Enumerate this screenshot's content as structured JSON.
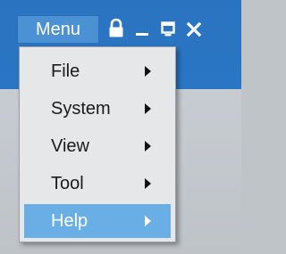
{
  "titlebar": {
    "menu_label": "Menu",
    "controls": [
      {
        "icon": "lock-icon"
      },
      {
        "icon": "minimize-icon"
      },
      {
        "icon": "restore-icon"
      },
      {
        "icon": "close-icon"
      }
    ]
  },
  "menu": {
    "items": [
      {
        "label": "File",
        "has_submenu": true
      },
      {
        "label": "System",
        "has_submenu": true
      },
      {
        "label": "View",
        "has_submenu": true
      },
      {
        "label": "Tool",
        "has_submenu": true
      },
      {
        "label": "Help",
        "has_submenu": true,
        "highlighted": true
      }
    ]
  },
  "colors": {
    "titlebar": "#2a73c0",
    "menu_button": "#4c91d4",
    "highlight": "#6aaee6",
    "menu_background": "#e6e7e9",
    "content_background": "#c4c9ce"
  }
}
